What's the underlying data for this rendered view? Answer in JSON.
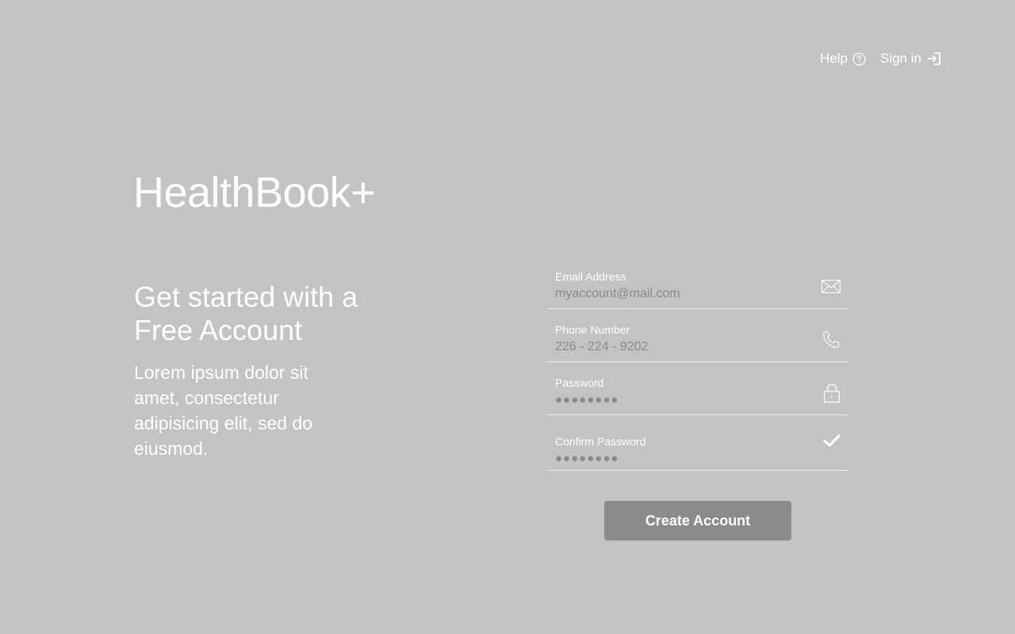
{
  "nav": {
    "help_label": "Help",
    "help_icon": "question-circle-icon",
    "signin_label": "Sign in",
    "signin_icon": "sign-in-arrow-icon"
  },
  "brand": {
    "title": "HealthBook+"
  },
  "hero": {
    "headline": "Get started with a Free Account",
    "description": "Lorem ipsum dolor sit amet, consectetur adipisicing elit, sed do eiusmod."
  },
  "form": {
    "email": {
      "label": "Email Address",
      "placeholder": "myaccount@mail.com",
      "icon": "envelope-icon"
    },
    "phone": {
      "label": "Phone Number",
      "placeholder": "226 - 224 - 9202",
      "icon": "phone-icon"
    },
    "password": {
      "label": "Password",
      "value": "●●●●●●●●",
      "icon": "lock-icon"
    },
    "confirm_password": {
      "label": "Confirm Password",
      "value": "●●●●●●●●",
      "icon": "checkmark-icon"
    },
    "submit_label": "Create Account"
  },
  "colors": {
    "background": "#c3c3c3",
    "text": "#ffffff",
    "placeholder": "#8a8a8a",
    "button": "#8b8b8b",
    "divider": "#ececec"
  }
}
